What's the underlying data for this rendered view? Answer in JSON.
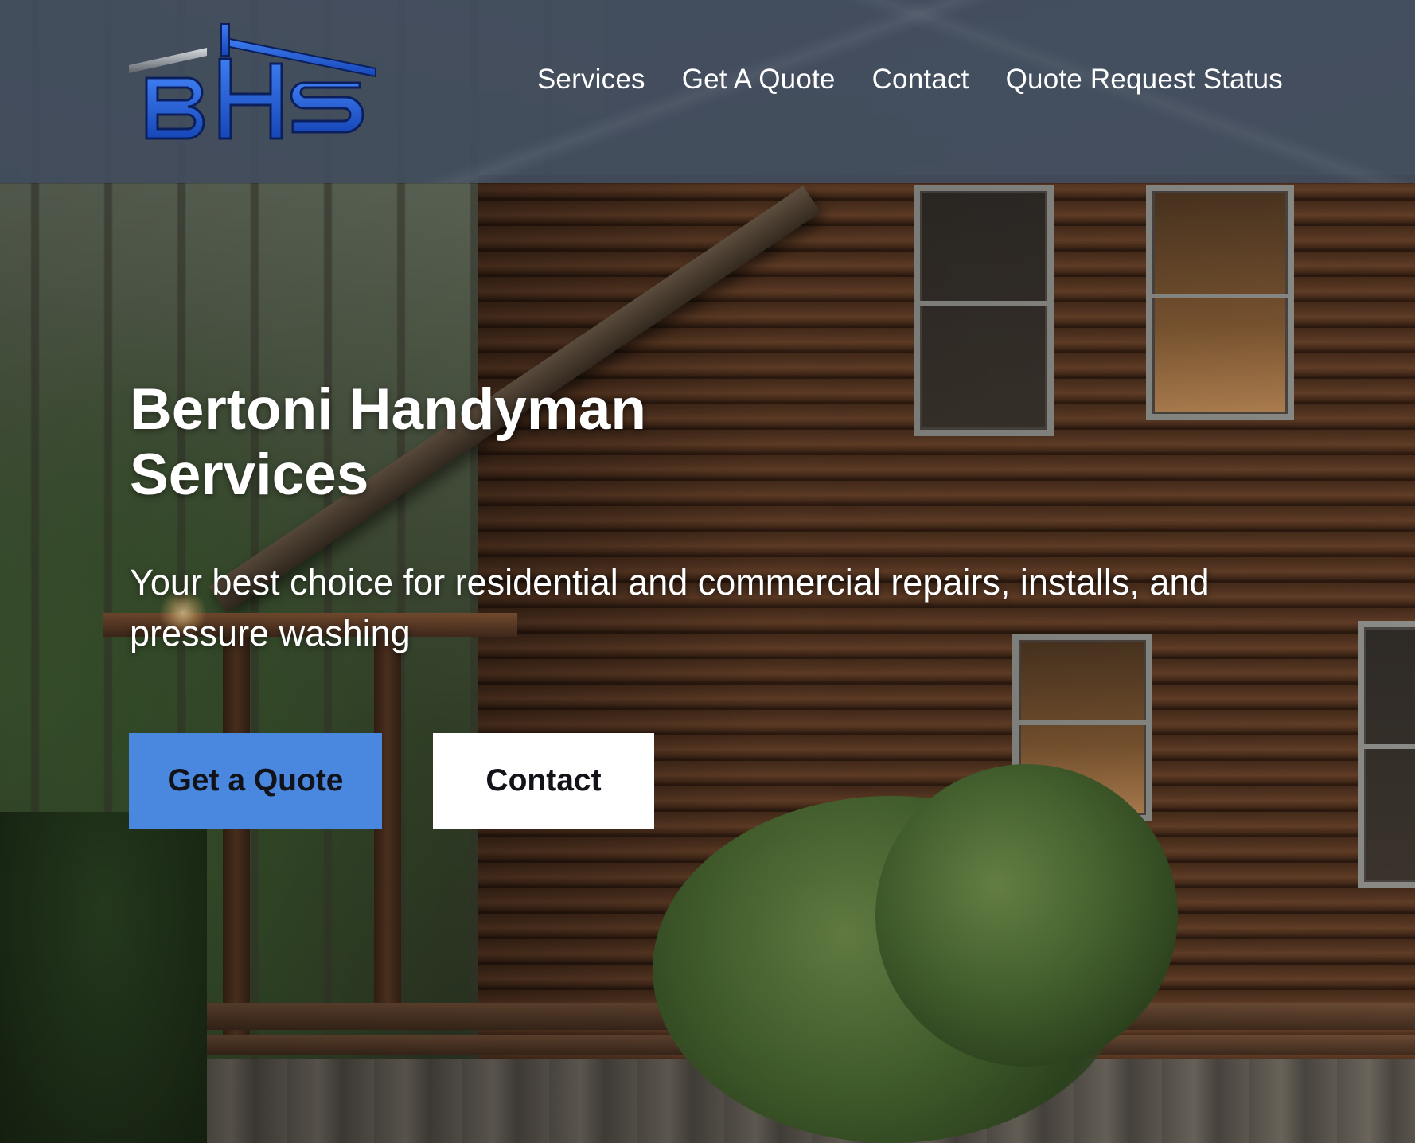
{
  "header": {
    "logo_text": "BHS",
    "logo_alt": "logo",
    "nav": [
      {
        "label": "Services"
      },
      {
        "label": "Get A Quote"
      },
      {
        "label": "Contact"
      },
      {
        "label": "Quote Request Status"
      }
    ]
  },
  "hero": {
    "title_line1": "Bertoni Handyman",
    "title_line2": "Services",
    "subtitle": "Your best choice for residential and commercial repairs, installs, and pressure washing",
    "buttons": {
      "primary_label": "Get a Quote",
      "secondary_label": "Contact"
    }
  },
  "colors": {
    "header_bg": "#424c5e",
    "primary_button": "#4a88e0",
    "secondary_button": "#ffffff",
    "logo_blue": "#1f5fd6",
    "text_light": "#ffffff",
    "button_text": "#111318"
  },
  "icons": {
    "logo": "bhs-house-logo-icon"
  }
}
